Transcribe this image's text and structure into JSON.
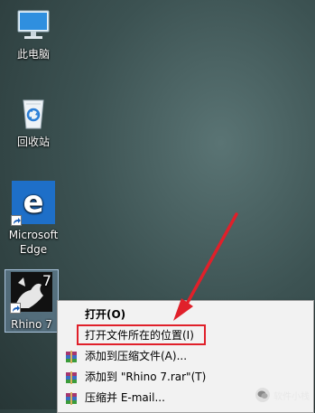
{
  "desktop": {
    "icons": [
      {
        "label": "此电脑",
        "icon": "computer-icon"
      },
      {
        "label": "回收站",
        "icon": "recycle-bin-icon"
      },
      {
        "label": "Microsoft\nEdge",
        "icon": "edge-icon"
      },
      {
        "label": "Rhino 7",
        "icon": "rhino-icon"
      }
    ]
  },
  "context_menu": {
    "items": [
      {
        "label": "打开(O)",
        "bold": true,
        "icon": ""
      },
      {
        "label": "打开文件所在的位置(I)",
        "bold": false,
        "icon": "",
        "highlighted": true
      },
      {
        "label": "添加到压缩文件(A)...",
        "bold": false,
        "icon": "winrar-icon"
      },
      {
        "label": "添加到 \"Rhino 7.rar\"(T)",
        "bold": false,
        "icon": "winrar-icon"
      },
      {
        "label": "压缩并 E-mail...",
        "bold": false,
        "icon": "winrar-icon"
      }
    ]
  },
  "watermark": {
    "text": "软件小栈"
  },
  "colors": {
    "highlight": "#e0202a",
    "edge_blue": "#1e6fc8"
  }
}
